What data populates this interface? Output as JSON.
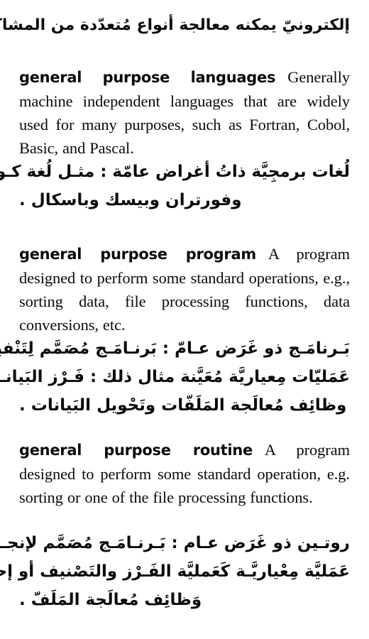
{
  "page": {
    "type": "scanned-dictionary-page",
    "language_pair": "English-Arabic",
    "background_color": "#ffffff",
    "text_color": "#0b0b0b"
  },
  "continuation": {
    "arabic_text": "إلكترونيّ يمكنه معالجة أنواع مُتعدّدة من المشاكل ."
  },
  "entries": [
    {
      "headword": "general purpose languages",
      "definition": "Generally machine independent languages that are widely used for many purposes, such as Fortran, Cobol, Basic, and Pascal.",
      "arabic_lines": [
        "لُغات برمجِيَّة ذاتُ أغراض عامّة : مثـل لُغة كـوبول",
        "وفورتران وبيسك وباسكال ."
      ]
    },
    {
      "headword": "general purpose program",
      "definition": "A program designed to perform some standard operations, e.g., sorting data, file processing functions, data conversions, etc.",
      "arabic_lines": [
        "بَـرنامَـج ذو غَرَض عـامّ : بَرنـامَـج مُصَمَّم لِتَنْفيـذ",
        "عَمَليّات مِعياريَّة مُعَيَّنة مثال ذلك : فَـرْز البَيانـات ،",
        "وظائِف مُعالَجة المَلَفّات وتَحْويل البَيانات ."
      ]
    },
    {
      "headword": "general purpose routine",
      "definition": "A program designed to perform some standard operation, e.g. sorting or one of the file processing functions.",
      "arabic_lines": [
        "روتـين ذو غَرَض عـام : بَـرنـامَـج مُصَمَّم لإنجـاز",
        "عَمَليَّة مِعْياريَّـة كَعَمليَّة الفَـرْز والتَصْنيف أو إحدى",
        "وَظائِف مُعالَجة المَلَفّ ."
      ]
    }
  ]
}
